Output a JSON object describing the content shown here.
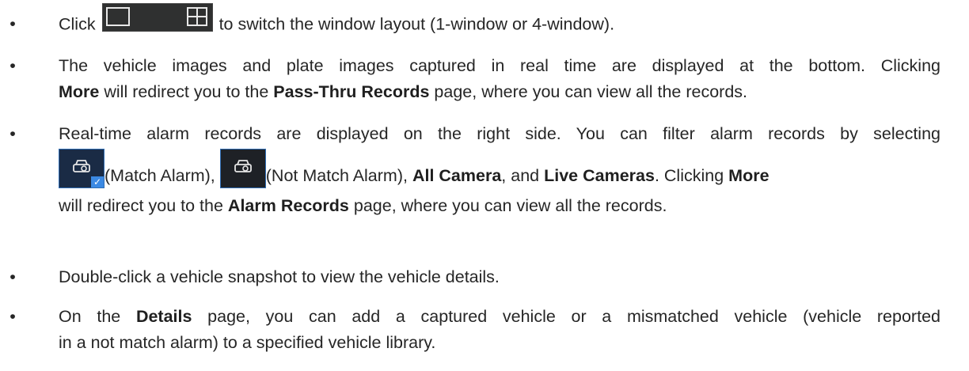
{
  "items": [
    {
      "click": "Click",
      "after_icons": "to switch the window layout (1-window or 4-window)."
    },
    {
      "line1": "The vehicle images and plate images captured in real time are displayed at the bottom. Clicking",
      "more": "More",
      "mid": "will redirect you to the",
      "page": "Pass-Thru Records",
      "end": "page, where you can view all the records."
    },
    {
      "line1": "Real-time alarm records are displayed on the right side. You can filter alarm records by selecting",
      "match": "(Match Alarm),",
      "not_match": "(Not Match Alarm),",
      "all_camera": "All Camera",
      "and": ", and",
      "live_cameras": "Live Cameras",
      "clicking": ". Clicking",
      "more": "More",
      "mid": "will redirect you to the",
      "page": "Alarm Records",
      "end": "page, where you can view all the records."
    },
    {
      "text": "Double-click a vehicle snapshot to view the vehicle details."
    },
    {
      "on_the": "On the",
      "details": "Details",
      "rest1": "page, you can add a captured vehicle or a mismatched vehicle (vehicle reported",
      "rest2": "in a not match alarm) to a specified vehicle library."
    }
  ],
  "icons": {
    "one_window": "single-window-layout-icon",
    "four_window": "four-window-layout-icon",
    "match_alarm": "match-alarm-icon",
    "not_match_alarm": "not-match-alarm-icon"
  },
  "colors": {
    "icon_bg": "#1e2126",
    "accent_blue": "#3b89e3"
  }
}
